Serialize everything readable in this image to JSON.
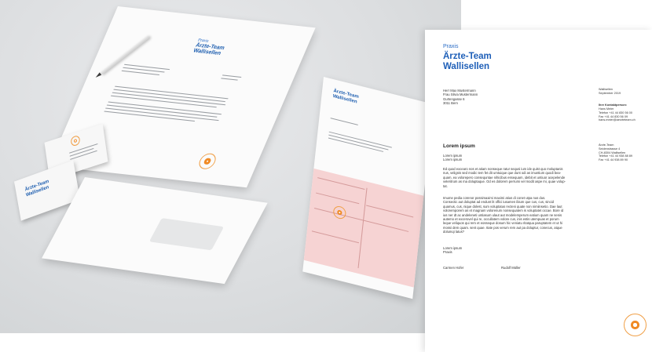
{
  "mockup": {
    "letterhead": {
      "praxis": "Praxis",
      "name": "Ärzte-Team\nWallisellen"
    },
    "card_name": "Ärzte-Team\nWallisellen",
    "form_name": "Ärzte-Team\nWallisellen"
  },
  "page": {
    "praxis": "Praxis",
    "name": "Ärzte-Team\nWallisellen",
    "recipient": "Herr Max Mustermann\nFrau Silvia Mustermann\nGurtengasse 6\n3011 Bern",
    "date": "Wallisellen\nSeptember 2019",
    "contact_title": "Ihre Kontaktperson:",
    "contact": "Hans Meier\nTelefon +41 44 830 56 00\nFax +41 44 830 56 09\nhans.meier@aerzteteam.ch",
    "sender": "Ärzte-Team\nSeidenstrasse 4\nCH-8304 Wallisellen\nTelefon +41 44 938 88 89\nFax +41 44 938 89 90",
    "heading": "Lorem ipsum",
    "salutation": "Lorem ipsum\nLorem ipsum",
    "para1": "Ed quod excearo nos et atiam nonseque ratur sequsi ium ide quist quo moluptanis\nnus, velignis sed modic tem fet dit umtuique que dunt odi as imuntium quodi bea-\nquam, ea volorepero consequntae nihicibus essequam, idebit et untiuor acepelende\nveleritrum as ma doluptaque. Od es dolorem perrumi vel modit aspe mi, quae volup-\ntat.",
    "para2": "Imume pedia corenor possimaximi maximi atius di conet utpa nus dus.\nConsectic aut doluptat ad endunt lit offici iusamen ibium que cus, cus, sincid\nquamus, cus, nique dolest, sum voluptatus recteni quate non nimiinsetio. Dae laut\nvoloremporem as et magnam volorenum nonsequatem is voluptatet occae. Bore id\nius ner dt ac andeleneti untiasum ulaut aut modelemperum eatium quam ne senis\nautemo et excerovel qui re, occullatem volore cus, inis estis utempuas et porum\nleque veliquos qui rem et eosseque dosum hic veniatu ritatqua paruptatem et ut hi\nmossi dem quam. sent quae. Itate pos verum rem aut pa doluptur, conecus, atque\ndolumqi latus?",
    "closing": "Lorem ipsum\nPraxis",
    "sign1": "Carmen Hofer",
    "sign2": "Rudolf Müller"
  },
  "colors": {
    "brand_blue": "#1e5fb8",
    "accent_orange": "#f08a24",
    "form_pink": "#f6d3d3"
  }
}
